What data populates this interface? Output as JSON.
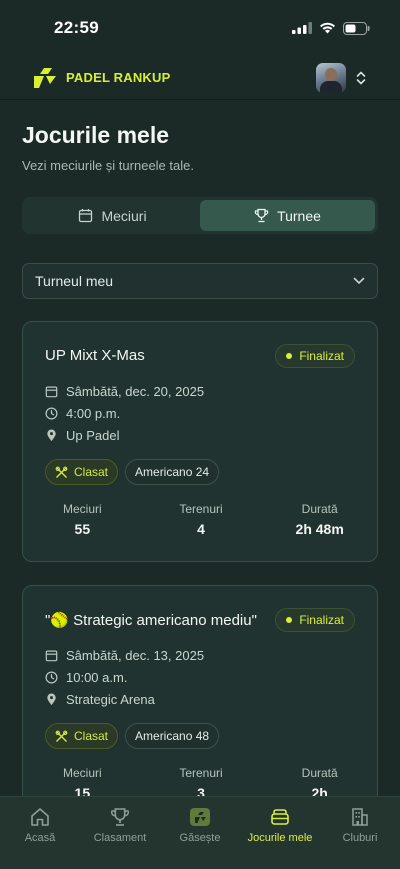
{
  "status_bar": {
    "time": "22:59"
  },
  "header": {
    "brand": "PADEL RANKUP"
  },
  "page": {
    "title": "Jocurile mele",
    "subtitle": "Vezi meciurile și turneele tale."
  },
  "tabs": [
    {
      "label": "Meciuri",
      "icon": "calendar-icon",
      "active": false
    },
    {
      "label": "Turnee",
      "icon": "trophy-icon",
      "active": true
    }
  ],
  "filter": {
    "selected": "Turneul meu"
  },
  "tournaments": [
    {
      "title": "UP Mixt X-Mas",
      "status": "Finalizat",
      "date": "Sâmbătă, dec. 20, 2025",
      "time": "4:00 p.m.",
      "location": "Up Padel",
      "tags": [
        "Clasat",
        "Americano 24"
      ],
      "stats": {
        "matches_label": "Meciuri",
        "matches": "55",
        "courts_label": "Terenuri",
        "courts": "4",
        "duration_label": "Durată",
        "duration": "2h 48m"
      }
    },
    {
      "title": "\"🥎 Strategic americano mediu\"",
      "status": "Finalizat",
      "date": "Sâmbătă, dec. 13, 2025",
      "time": "10:00 a.m.",
      "location": "Strategic Arena",
      "tags": [
        "Clasat",
        "Americano 48"
      ],
      "stats": {
        "matches_label": "Meciuri",
        "matches": "15",
        "courts_label": "Terenuri",
        "courts": "3",
        "duration_label": "Durată",
        "duration": "2h"
      }
    }
  ],
  "bottom_nav": [
    {
      "label": "Acasă",
      "icon": "home-icon"
    },
    {
      "label": "Clasament",
      "icon": "trophy-icon"
    },
    {
      "label": "Găsește",
      "icon": "logo-icon"
    },
    {
      "label": "Jocurile mele",
      "icon": "games-icon",
      "active": true
    },
    {
      "label": "Cluburi",
      "icon": "building-icon"
    }
  ],
  "colors": {
    "accent": "#d9ef3d",
    "background": "#1b2a26",
    "card": "#213330"
  }
}
